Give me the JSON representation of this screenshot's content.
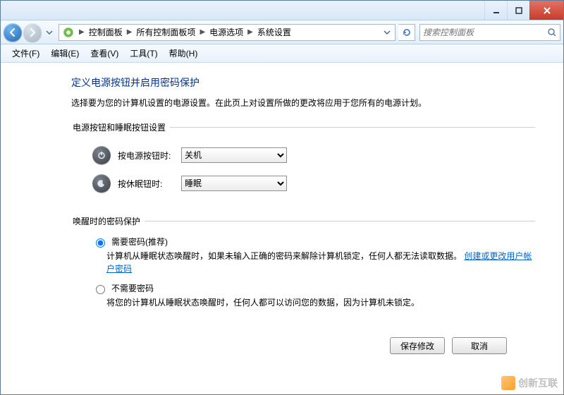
{
  "titlebar": {
    "min": "",
    "max": "",
    "close": ""
  },
  "breadcrumb": {
    "items": [
      "控制面板",
      "所有控制面板项",
      "电源选项",
      "系统设置"
    ]
  },
  "search": {
    "placeholder": "搜索控制面板"
  },
  "menubar": {
    "items": [
      "文件(F)",
      "编辑(E)",
      "查看(V)",
      "工具(T)",
      "帮助(H)"
    ]
  },
  "page": {
    "heading": "定义电源按钮并启用密码保护",
    "desc": "选择要为您的计算机设置的电源设置。在此页上对设置所做的更改将应用于您所有的电源计划。",
    "section1_legend": "电源按钮和睡眠按钮设置",
    "row1_label": "按电源按钮时:",
    "row1_value": "关机",
    "row2_label": "按休眠钮时:",
    "row2_value": "睡眠",
    "section2_legend": "唤醒时的密码保护",
    "radio1_label": "需要密码(推荐)",
    "radio1_desc_a": "计算机从睡眠状态唤醒时，如果未输入正确的密码来解除计算机锁定，任何人都无法读取数据。",
    "radio1_link": "创建或更改用户帐户密码",
    "radio2_label": "不需要密码",
    "radio2_desc": "将您的计算机从睡眠状态唤醒时，任何人都可以访问您的数据，因为计算机未锁定。"
  },
  "footer": {
    "save": "保存修改",
    "cancel": "取消"
  },
  "watermark": "创新互联"
}
